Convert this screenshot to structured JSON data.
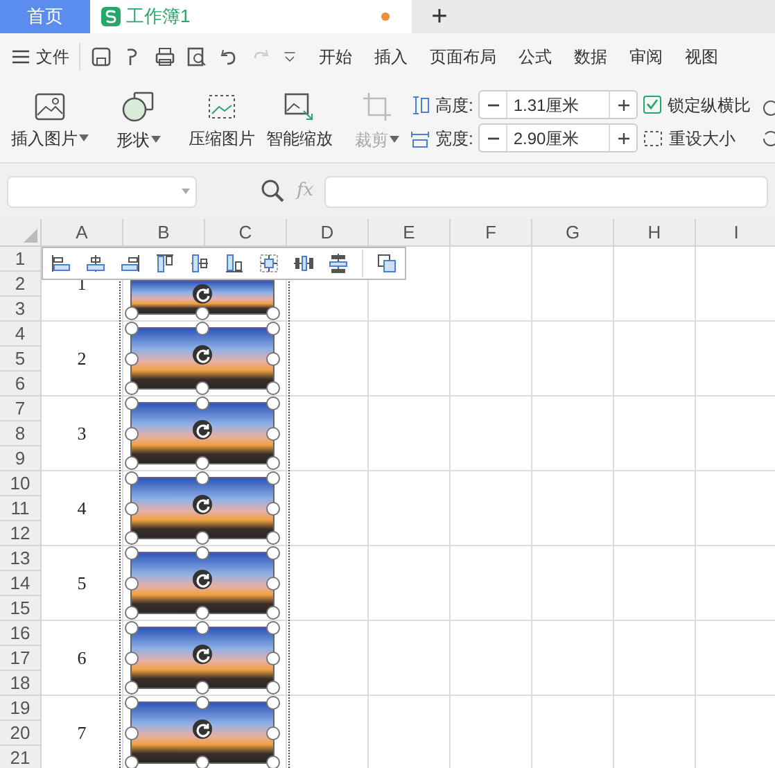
{
  "tabs": [
    {
      "label": "首页",
      "kind": "home",
      "selected": false
    },
    {
      "label": "工作簿1",
      "kind": "doc",
      "selected": true,
      "modified": true
    }
  ],
  "new_tab": "+",
  "menu": {
    "file": "文件",
    "items": [
      "开始",
      "插入",
      "页面布局",
      "公式",
      "数据",
      "审阅",
      "视图"
    ]
  },
  "ribbon": {
    "insert_picture": "插入图片",
    "shape": "形状",
    "compress": "压缩图片",
    "smart_scale": "智能缩放",
    "crop": {
      "label": "裁剪",
      "disabled": true
    },
    "height": {
      "label": "高度:",
      "value": "1.31厘米"
    },
    "width": {
      "label": "宽度:",
      "value": "2.90厘米"
    },
    "lock_ratio": {
      "label": "锁定纵横比",
      "checked": true
    },
    "reset_size": "重设大小"
  },
  "formula_bar": {
    "fx": "fx"
  },
  "sheet": {
    "columns": [
      "A",
      "B",
      "C",
      "D",
      "E",
      "F",
      "G",
      "H",
      "I"
    ],
    "rows": [
      "1",
      "2",
      "3",
      "4",
      "5",
      "6",
      "7",
      "8",
      "9",
      "10",
      "11",
      "12",
      "13",
      "14",
      "15",
      "16",
      "17",
      "18",
      "19",
      "20",
      "21"
    ],
    "column_a": [
      "1",
      "2",
      "3",
      "4",
      "5",
      "6",
      "7"
    ],
    "pictures": [
      {
        "selected": true
      },
      {
        "selected": true
      },
      {
        "selected": true
      },
      {
        "selected": true
      },
      {
        "selected": true
      },
      {
        "selected": true
      },
      {
        "selected": true
      }
    ]
  }
}
